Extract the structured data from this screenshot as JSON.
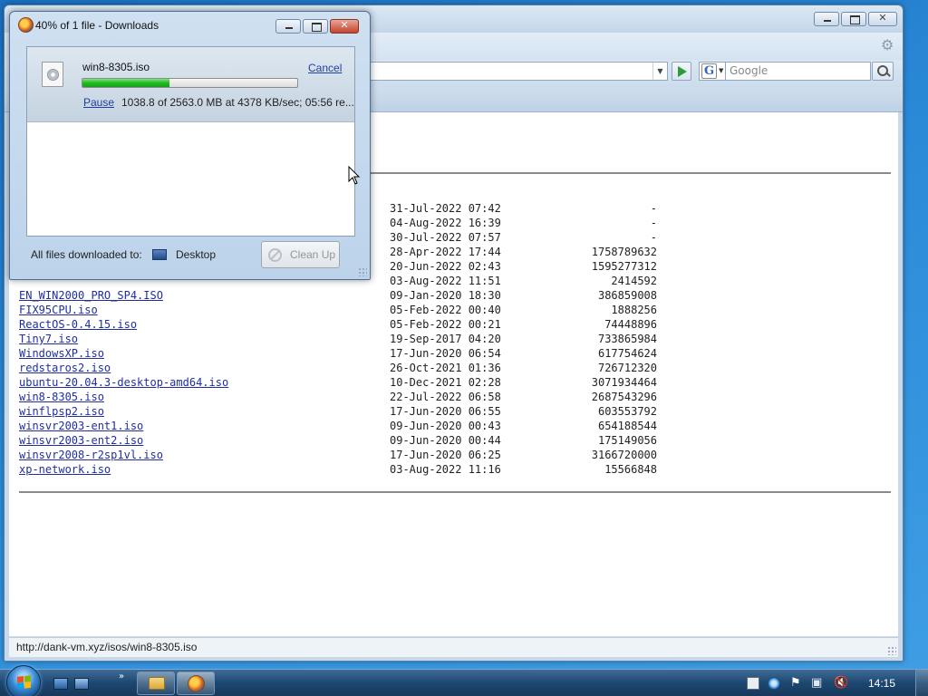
{
  "browser": {
    "search_placeholder": "Google",
    "search_engine_letter": "G",
    "status_text": "http://dank-vm.xyz/isos/win8-8305.iso"
  },
  "listing": [
    {
      "name": "",
      "date": "31-Jul-2022 07:42",
      "size": "-"
    },
    {
      "name": "",
      "date": "04-Aug-2022 16:39",
      "size": "-"
    },
    {
      "name": "",
      "date": "30-Jul-2022 07:57",
      "size": "-"
    },
    {
      "name": "",
      "date": "28-Apr-2022 17:44",
      "size": "1758789632"
    },
    {
      "name": "",
      "date": "20-Jun-2022 02:43",
      "size": "1595277312"
    },
    {
      "name": "",
      "date": "03-Aug-2022 11:51",
      "size": "2414592"
    },
    {
      "name": "EN_WIN2000_PRO_SP4.ISO",
      "date": "09-Jan-2020 18:30",
      "size": "386859008"
    },
    {
      "name": "FIX95CPU.iso",
      "date": "05-Feb-2022 00:40",
      "size": "1888256"
    },
    {
      "name": "ReactOS-0.4.15.iso",
      "date": "05-Feb-2022 00:21",
      "size": "74448896"
    },
    {
      "name": "Tiny7.iso",
      "date": "19-Sep-2017 04:20",
      "size": "733865984"
    },
    {
      "name": "WindowsXP.iso",
      "date": "17-Jun-2020 06:54",
      "size": "617754624"
    },
    {
      "name": "redstaros2.iso",
      "date": "26-Oct-2021 01:36",
      "size": "726712320"
    },
    {
      "name": "ubuntu-20.04.3-desktop-amd64.iso",
      "date": "10-Dec-2021 02:28",
      "size": "3071934464"
    },
    {
      "name": "win8-8305.iso",
      "date": "22-Jul-2022 06:58",
      "size": "2687543296"
    },
    {
      "name": "winflpsp2.iso",
      "date": "17-Jun-2020 06:55",
      "size": "603553792"
    },
    {
      "name": "winsvr2003-ent1.iso",
      "date": "09-Jun-2020 00:43",
      "size": "654188544"
    },
    {
      "name": "winsvr2003-ent2.iso",
      "date": "09-Jun-2020 00:44",
      "size": "175149056"
    },
    {
      "name": "winsvr2008-r2sp1vl.iso",
      "date": "17-Jun-2020 06:25",
      "size": "3166720000"
    },
    {
      "name": "xp-network.iso",
      "date": "03-Aug-2022 11:16",
      "size": "15566848"
    }
  ],
  "downloads": {
    "window_title": "40% of 1 file - Downloads",
    "file_name": "win8-8305.iso",
    "cancel_label": "Cancel",
    "pause_label": "Pause",
    "status_text": "1038.8 of 2563.0 MB at 4378 KB/sec; 05:56 re...",
    "progress_fraction": 0.405,
    "footer_label": "All files downloaded to:",
    "destination": "Desktop",
    "cleanup_label": "Clean Up",
    "progress_color": "#21b921"
  },
  "taskbar": {
    "clock": "14:15",
    "quicklaunch_more": "»"
  }
}
